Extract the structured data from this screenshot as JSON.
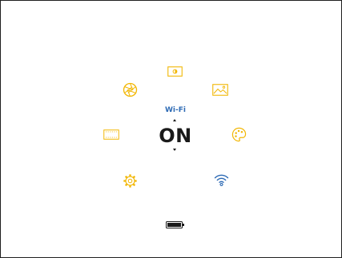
{
  "menu": {
    "center": {
      "label": "Wi-Fi",
      "value": "ON"
    },
    "items": [
      {
        "icon": "display-icon",
        "state": "inactive"
      },
      {
        "icon": "gallery-icon",
        "state": "inactive"
      },
      {
        "icon": "palette-icon",
        "state": "inactive"
      },
      {
        "icon": "wifi-icon",
        "state": "active"
      },
      {
        "icon": "gear-icon",
        "state": "inactive"
      },
      {
        "icon": "image-size-icon",
        "state": "inactive"
      },
      {
        "icon": "aperture-icon",
        "state": "inactive"
      }
    ]
  },
  "status": {
    "battery_icon": "battery-icon",
    "battery_level": 1.0
  },
  "colors": {
    "inactive": "#f2b705",
    "active": "#2e6bb5",
    "text_dark": "#1a1a1a",
    "label_blue": "#2e6bb5"
  }
}
